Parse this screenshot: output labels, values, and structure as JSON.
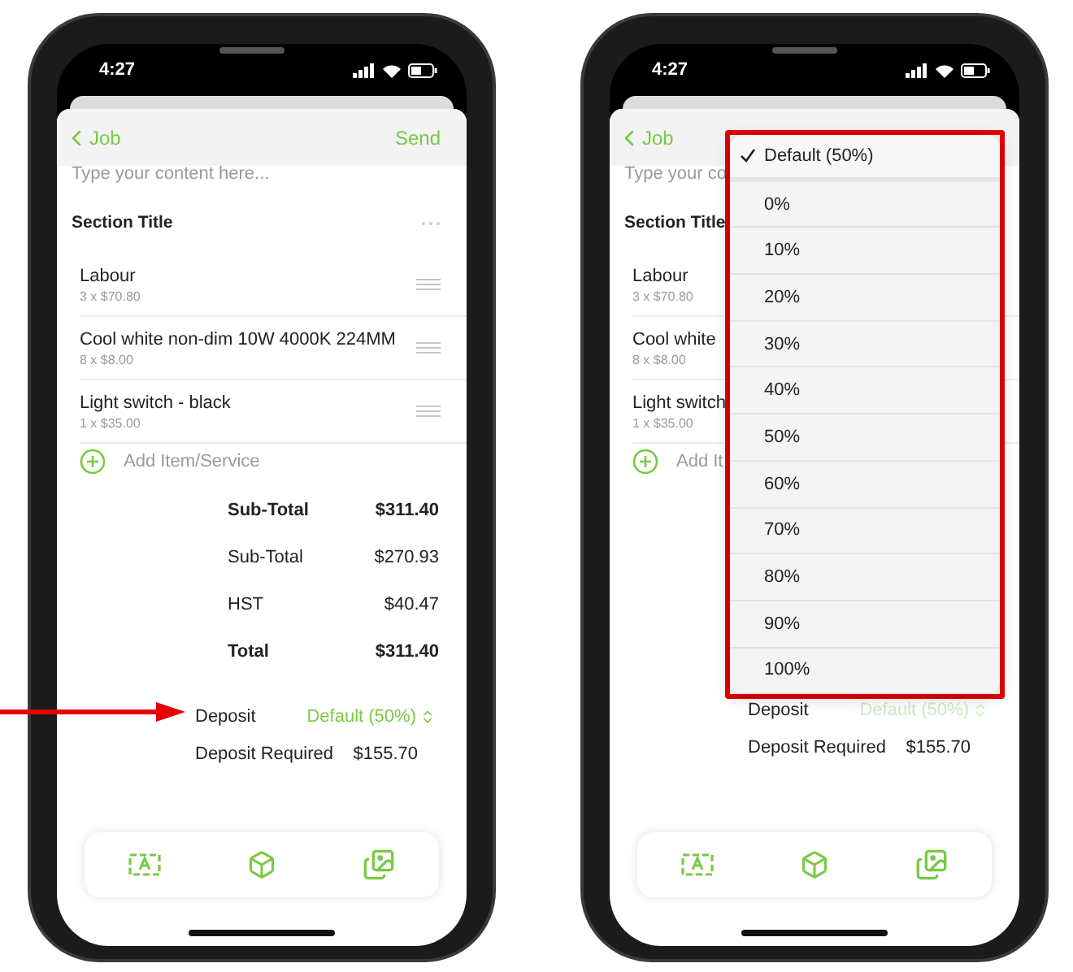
{
  "phones": [
    {
      "status": {
        "time": "4:27"
      },
      "nav": {
        "back": "Job",
        "action": "Send"
      },
      "placeholder": "Type your content here...",
      "section": {
        "title": "Section Title"
      },
      "handles_visible": true,
      "items": [
        {
          "name": "Labour",
          "detail": "3 x $70.80"
        },
        {
          "name": "Cool white non-dim 10W 4000K 224MM",
          "detail": "8 x $8.00"
        },
        {
          "name": "Light switch - black",
          "detail": "1 x $35.00"
        }
      ],
      "add_item": "Add Item/Service",
      "totals": [
        {
          "label": "Sub-Total",
          "amount": "$311.40",
          "bold": true
        },
        {
          "label": "Sub-Total",
          "amount": "$270.93",
          "bold": false
        },
        {
          "label": "HST",
          "amount": "$40.47",
          "bold": false
        },
        {
          "label": "Total",
          "amount": "$311.40",
          "bold": true
        }
      ],
      "deposit": {
        "label": "Deposit",
        "value": "Default (50%)",
        "faded": false
      },
      "deposit_required": {
        "label": "Deposit Required",
        "amount": "$155.70"
      },
      "annotation_arrow": true
    },
    {
      "status": {
        "time": "4:27"
      },
      "nav": {
        "back": "Job"
      },
      "placeholder": "Type your co",
      "section": {
        "title": "Section Title"
      },
      "handles_visible": false,
      "items": [
        {
          "name": "Labour",
          "detail": "3 x $70.80"
        },
        {
          "name": "Cool white",
          "detail": "8 x $8.00"
        },
        {
          "name": "Light switch",
          "detail": "1 x $35.00"
        }
      ],
      "add_item": "Add It",
      "deposit": {
        "label": "Deposit",
        "value": "Default (50%)",
        "faded": true
      },
      "deposit_required": {
        "label": "Deposit Required",
        "amount": "$155.70"
      },
      "menu": {
        "highlighted": true,
        "options": [
          {
            "label": "Default (50%)",
            "selected": true
          },
          {
            "label": "0%",
            "selected": false
          },
          {
            "label": "10%",
            "selected": false
          },
          {
            "label": "20%",
            "selected": false
          },
          {
            "label": "30%",
            "selected": false
          },
          {
            "label": "40%",
            "selected": false
          },
          {
            "label": "50%",
            "selected": false
          },
          {
            "label": "60%",
            "selected": false
          },
          {
            "label": "70%",
            "selected": false
          },
          {
            "label": "80%",
            "selected": false
          },
          {
            "label": "90%",
            "selected": false
          },
          {
            "label": "100%",
            "selected": false
          }
        ]
      }
    }
  ]
}
